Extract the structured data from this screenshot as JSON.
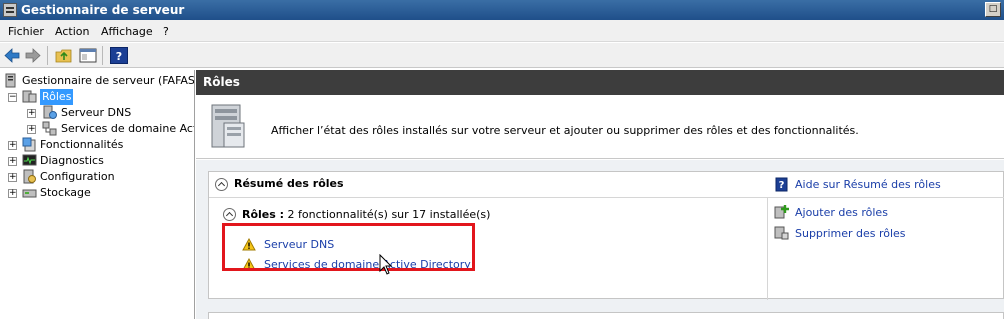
{
  "window": {
    "title": "Gestionnaire de serveur"
  },
  "menu": [
    "Fichier",
    "Action",
    "Affichage",
    "?"
  ],
  "tree": {
    "root": "Gestionnaire de serveur (FAFASER",
    "roles": "Rôles",
    "dns": "Serveur DNS",
    "ad": "Services de domaine Active",
    "features": "Fonctionnalités",
    "diagnostics": "Diagnostics",
    "configuration": "Configuration",
    "storage": "Stockage"
  },
  "content": {
    "header": "Rôles",
    "intro": "Afficher l’état des rôles installés sur votre serveur et ajouter ou supprimer des rôles et des fonctionnalités.",
    "summary_title": "Résumé des rôles",
    "summary_help": "Aide sur Résumé des rôles",
    "roles_label": "Rôles :",
    "roles_count": " 2 fonctionnalité(s) sur 17 installée(s)",
    "roles": [
      "Serveur DNS",
      "Services de domaine Active Directory"
    ],
    "add_roles": "Ajouter des rôles",
    "remove_roles": "Supprimer des rôles"
  },
  "colors": {
    "title_bar": "#1f4f8a",
    "header_bar": "#3d3d3d",
    "link": "#1a3ea8",
    "highlight": "#e2161c",
    "selection": "#3399ff"
  }
}
